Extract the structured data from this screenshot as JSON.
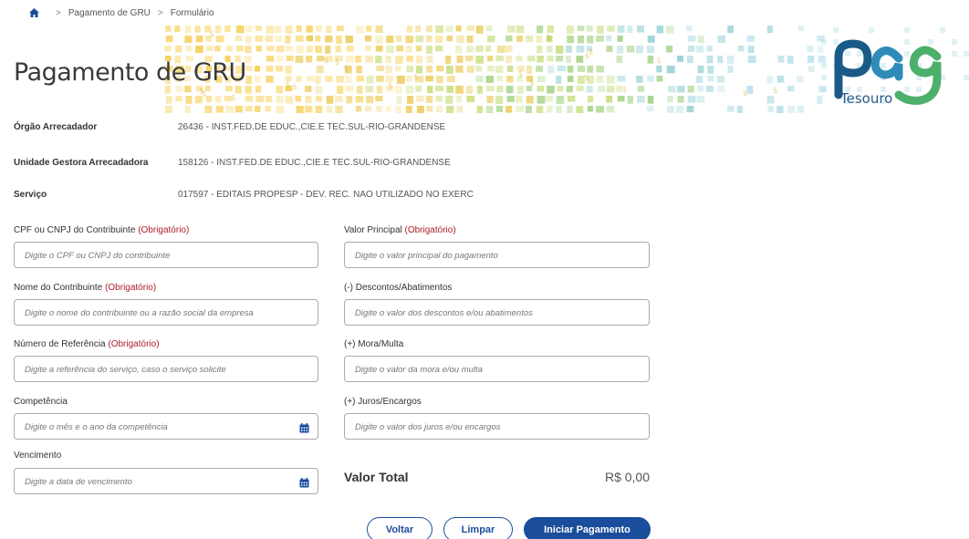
{
  "breadcrumb": {
    "items": [
      "Pagamento de GRU",
      "Formulário"
    ]
  },
  "header": {
    "title": "Pagamento de GRU",
    "logo_text": "Tesouro"
  },
  "info": [
    {
      "label": "Órgão Arrecadador",
      "value": "26436 - INST.FED.DE EDUC.,CIE.E TEC.SUL-RIO-GRANDENSE"
    },
    {
      "label": "Unidade Gestora Arrecadadora",
      "value": "158126 - INST.FED.DE EDUC.,CIE.E TEC.SUL-RIO-GRANDENSE"
    },
    {
      "label": "Serviço",
      "value": "017597 - EDITAIS PROPESP - DEV. REC. NAO UTILIZADO NO EXERC"
    }
  ],
  "required_marker": "(Obrigatório)",
  "fields": {
    "cpf": {
      "label": "CPF ou CNPJ do Contribuinte",
      "placeholder": "Digite o CPF ou CNPJ do contribuinte"
    },
    "nome": {
      "label": "Nome do Contribuinte",
      "placeholder": "Digite o nome do contribuinte ou a razão social da empresa"
    },
    "referencia": {
      "label": "Número de Referência",
      "placeholder": "Digite a referência do serviço, caso o serviço solicite"
    },
    "competencia": {
      "label": "Competência",
      "placeholder": "Digite o mês e o ano da competência"
    },
    "vencimento": {
      "label": "Vencimento",
      "placeholder": "Digite a data de vencimento"
    },
    "valor_principal": {
      "label": "Valor Principal",
      "placeholder": "Digite o valor principal do pagamento"
    },
    "descontos": {
      "label": "(-) Descontos/Abatimentos",
      "placeholder": "Digite o valor dos descontos e/ou abatimentos"
    },
    "mora": {
      "label": "(+) Mora/Multa",
      "placeholder": "Digite o valor da mora e/ou multa"
    },
    "juros": {
      "label": "(+) Juros/Encargos",
      "placeholder": "Digite o valor dos juros e/ou encargos"
    }
  },
  "total": {
    "label": "Valor Total",
    "value": "R$ 0,00"
  },
  "buttons": {
    "voltar": "Voltar",
    "limpar": "Limpar",
    "iniciar": "Iniciar Pagamento"
  },
  "colors": {
    "primary": "#1a4d9c",
    "required": "#b0202a"
  },
  "icons": {
    "home": "home-icon",
    "calendar": "calendar-icon"
  }
}
